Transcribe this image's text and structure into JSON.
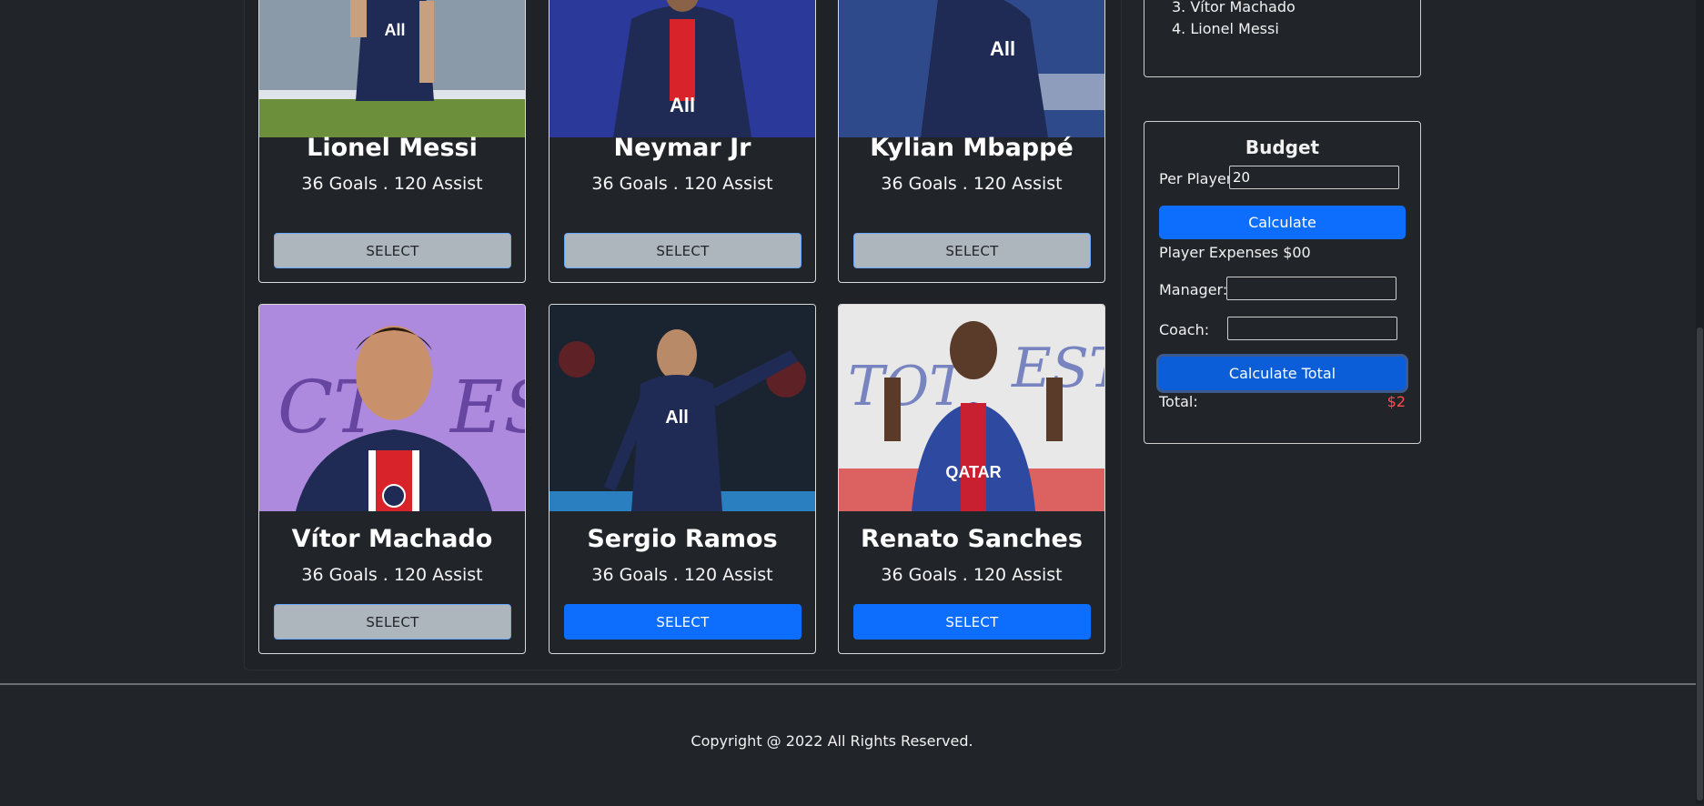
{
  "players": [
    {
      "name": "Lionel Messi",
      "stats": "36 Goals . 120 Assist",
      "button": "SELECT",
      "state": "disabled",
      "bg": "#8a9aa8",
      "field": "#6b8f3a"
    },
    {
      "name": "Neymar Jr",
      "stats": "36 Goals . 120 Assist",
      "button": "SELECT",
      "state": "disabled",
      "bg": "#2b3a9a",
      "field": "#2b3a9a"
    },
    {
      "name": "Kylian Mbappé",
      "stats": "36 Goals . 120 Assist",
      "button": "SELECT",
      "state": "disabled",
      "bg": "#2e4a8a",
      "field": "#3a5ea8"
    },
    {
      "name": "Vítor Machado",
      "stats": "36 Goals . 120 Assist",
      "button": "SELECT",
      "state": "disabled",
      "bg": "#8a5ec8",
      "field": "#b9a0e0"
    },
    {
      "name": "Sergio Ramos",
      "stats": "36 Goals . 120 Assist",
      "button": "SELECT",
      "state": "active",
      "bg": "#1a2430",
      "field": "#2a7fc0"
    },
    {
      "name": "Renato Sanches",
      "stats": "36 Goals . 120 Assist",
      "button": "SELECT",
      "state": "active",
      "bg": "#e8e8e8",
      "field": "#d84040"
    }
  ],
  "selected": {
    "items": [
      "3. Vítor Machado",
      "4. Lionel Messi"
    ]
  },
  "budget": {
    "title": "Budget",
    "per_player_label": "Per Player:",
    "per_player_value": "20",
    "calculate_label": "Calculate",
    "player_expenses_label": "Player Expenses $00",
    "manager_label": "Manager:",
    "manager_value": "",
    "coach_label": "Coach:",
    "coach_value": "",
    "calculate_total_label": "Calculate Total",
    "total_label": "Total:",
    "total_value": "$2"
  },
  "footer": {
    "copyright": "Copyright @ 2022 All Rights Reserved."
  },
  "colors": {
    "accent": "#0d6efd",
    "disabled": "#adb5bd",
    "background": "#212529",
    "total_red": "#ff4d4f",
    "kit_navy": "#1f2a55",
    "kit_red": "#d8232a"
  }
}
